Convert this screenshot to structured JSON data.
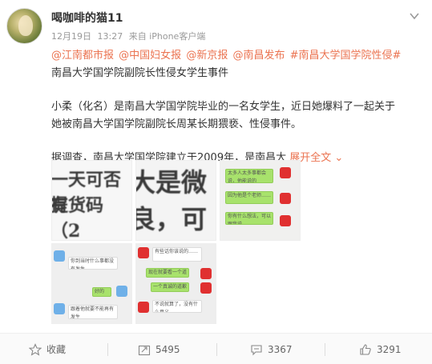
{
  "author": {
    "name": "喝咖啡的猫11"
  },
  "meta": {
    "date": "12月19日",
    "time": "13:27",
    "source": "来自 iPhone客户端"
  },
  "post": {
    "tags": [
      "@江南都市报",
      "@中国妇女报",
      "@新京报",
      "@南昌发布",
      "#南昌大学国学院性侵#"
    ],
    "headline": "南昌大学国学院副院长性侵女学生事件",
    "para1": "小柔（化名）是南昌大学国学院毕业的一名女学生，近日她爆料了一起关于她被南昌大学国学院副院长周某长期猥亵、性侵事件。",
    "para2": "据调查，南昌大学国学院建立于2009年，是南昌大",
    "expand_label": "展开全文",
    "expand_arrow": "⌄"
  },
  "images": {
    "t1_line1": "一天可否有",
    "t1_line2": "提货码（2",
    "t2_line1": "大是微",
    "t2_line2": "良，可能",
    "t3_msg1": "太多人太多事都会说，他能说的",
    "t3_msg2": "因为他是个老师……",
    "t3_msg3": "你有什么想法，可以跟我说",
    "t4_msg1": "你到当时什么事都没有发生",
    "t4_msg2": "好的",
    "t4_msg3": "跟着他就要不能再有发生",
    "t5_msg1": "有些话你该说的……",
    "t5_msg2": "现在就要看一个道歉",
    "t5_msg3": "一个真诚的道歉",
    "t5_msg4": "不说就算了，没有什么意义"
  },
  "actions": {
    "favorite_label": "收藏",
    "forward_count": "5495",
    "comment_count": "3367",
    "like_count": "3291"
  },
  "colors": {
    "link": "#eb7350",
    "meta": "#999999",
    "text": "#333333"
  }
}
